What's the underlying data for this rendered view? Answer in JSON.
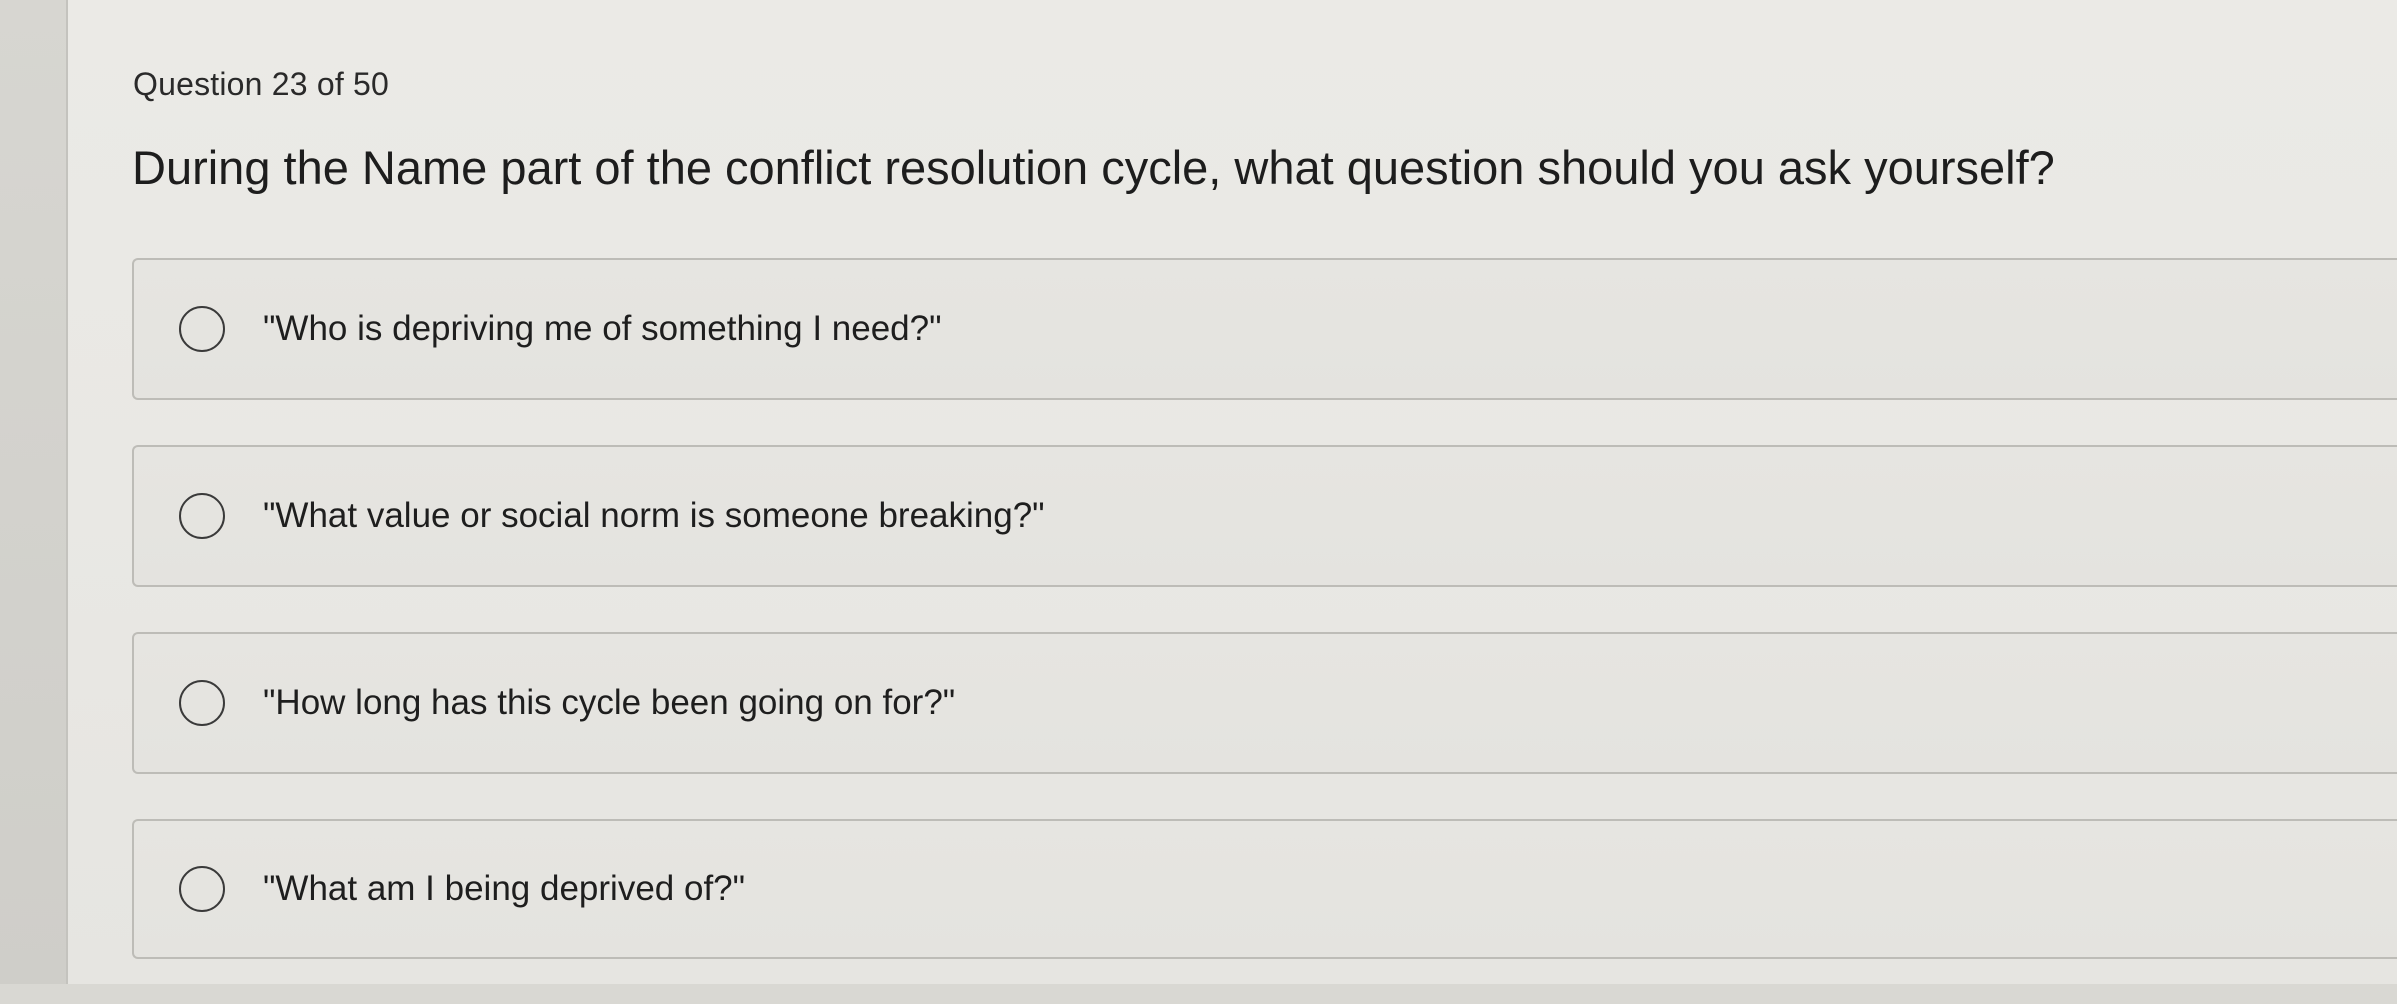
{
  "quiz": {
    "counter": "Question 23 of 50",
    "question": "During the Name part of the conflict resolution cycle, what question should you ask yourself?",
    "options": [
      {
        "label": "\"Who is depriving me of something I need?\"",
        "selected": false
      },
      {
        "label": "\"What value or social norm is someone breaking?\"",
        "selected": false
      },
      {
        "label": "\"How long has this cycle been going on for?\"",
        "selected": false
      },
      {
        "label": "\"What am I being deprived of?\"",
        "selected": false
      }
    ]
  }
}
